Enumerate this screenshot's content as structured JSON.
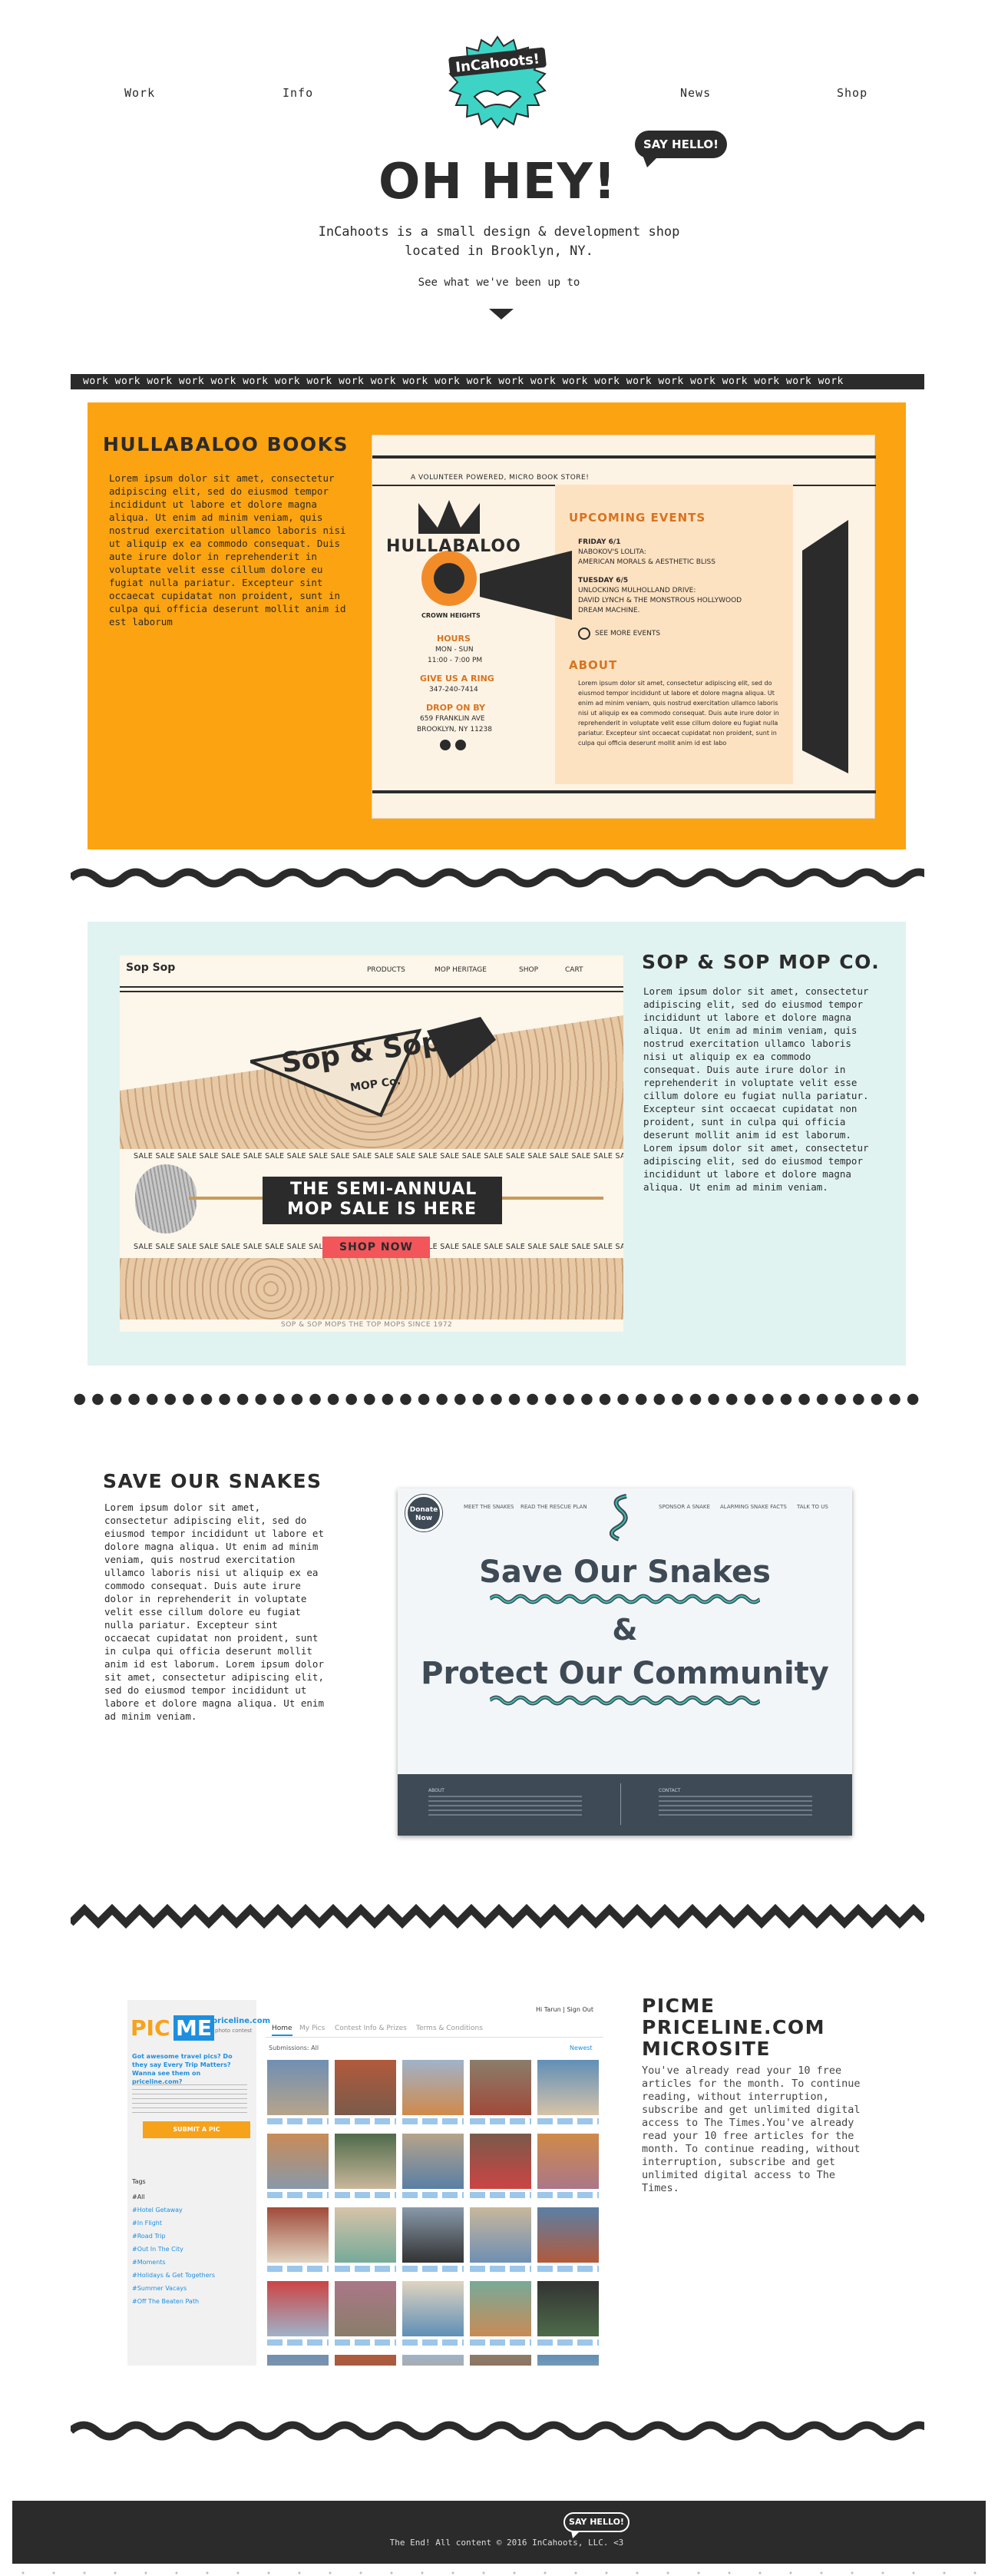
{
  "nav": {
    "work": "Work",
    "info": "Info",
    "logo_text": "InCahoots!",
    "news": "News",
    "shop": "Shop"
  },
  "hero": {
    "title": "OH HEY!",
    "say_hello": "SAY HELLO!",
    "subtitle_line1": "InCahoots is a small design & development shop",
    "subtitle_line2": "located in Brooklyn, NY.",
    "see_link": "See what we've been up to"
  },
  "work_bar": "work work work work work work work work work work work work work work work work work work work work work work work work",
  "projects": {
    "hullabaloo": {
      "title": "HULLABALOO BOOKS",
      "body": "Lorem ipsum dolor sit amet, consectetur adipiscing elit, sed do eiusmod tempor incididunt ut labore et dolore magna aliqua. Ut enim ad minim veniam, quis nostrud exercitation ullamco laboris nisi ut aliquip ex ea commodo consequat. Duis aute irure dolor in reprehenderit in voluptate velit esse cillum dolore eu fugiat nulla pariatur. Excepteur sint occaecat cupidatat non proident, sunt in culpa qui officia deserunt mollit anim id est laborum",
      "bg_color": "#fca311",
      "mock": {
        "tagline": "A VOLUNTEER POWERED, MICRO BOOK STORE!",
        "brand": "HULLABALOO",
        "location": "CROWN HEIGHTS",
        "hours_title": "HOURS",
        "hours_days": "MON - SUN",
        "hours_time": "11:00 - 7:00 PM",
        "ring_title": "GIVE US A RING",
        "phone": "347-240-7414",
        "drop_title": "DROP ON BY",
        "address1": "659 FRANKLIN AVE",
        "address2": "BROOKLYN, NY 11238",
        "events_title": "UPCOMING EVENTS",
        "event1_date": "FRIDAY 6/1",
        "event1_l1": "NABOKOV'S LOLITA:",
        "event1_l2": "AMERICAN MORALS & AESTHETIC BLISS",
        "event2_date": "TUESDAY 6/5",
        "event2_l1": "UNLOCKING MULHOLLAND DRIVE:",
        "event2_l2": "DAVID LYNCH & THE MONSTROUS HOLLYWOOD",
        "event2_l3": "DREAM MACHINE.",
        "see_more": "SEE MORE EVENTS",
        "about_title": "ABOUT",
        "about_body": "Lorem ipsum dolor sit amet, consectetur adipiscing elit, sed do eiusmod tempor incididunt ut labore et dolore magna aliqua. Ut enim ad minim veniam, quis nostrud exercitation ullamco laboris nisi ut aliquip ex ea commodo consequat. Duis aute irure dolor in reprehenderit in voluptate velit esse cillum dolore eu fugiat nulla pariatur. Excepteur sint occaecat cupidatat non proident, sunt in culpa qui officia deserunt mollit anim id est labo"
      }
    },
    "sopsop": {
      "title": "SOP & SOP MOP CO.",
      "body": "Lorem ipsum dolor sit amet, consectetur adipiscing elit, sed do eiusmod tempor incididunt ut labore et dolore magna aliqua. Ut enim ad minim veniam, quis nostrud exercitation ullamco laboris nisi ut aliquip ex ea commodo consequat. Duis aute irure dolor in reprehenderit in voluptate velit esse cillum dolore eu fugiat nulla pariatur. Excepteur sint occaecat cupidatat non proident, sunt in culpa qui officia deserunt mollit anim id est laborum. Lorem ipsum dolor sit amet, consectetur adipiscing elit, sed do eiusmod tempor incididunt ut labore et dolore magna aliqua. Ut enim ad minim veniam.",
      "bg_color": "#e0f3f1",
      "mock": {
        "logo": "Sop Sop",
        "nav_products": "PRODUCTS",
        "nav_heritage": "MOP HERITAGE",
        "nav_shop": "SHOP",
        "nav_cart": "CART",
        "sign_brand": "Sop & Sop",
        "sign_sub": "MOP Co.",
        "sale_strip": "SALE SALE SALE SALE SALE SALE SALE SALE SALE SALE SALE SALE SALE SALE SALE SALE SALE SALE SALE SALE SALE SALE SALE SALE",
        "banner_l1": "THE SEMI-ANNUAL",
        "banner_l2": "MOP SALE IS HERE",
        "shop_now": "SHOP NOW",
        "footer": "SOP & SOP MOPS THE TOP MOPS SINCE 1972"
      }
    },
    "snakes": {
      "title": "SAVE OUR SNAKES",
      "body": "Lorem ipsum dolor sit amet, consectetur adipiscing elit, sed do eiusmod tempor incididunt ut labore et dolore magna aliqua. Ut enim ad minim veniam, quis nostrud exercitation ullamco laboris nisi ut aliquip ex ea commodo consequat. Duis aute irure dolor in reprehenderit in voluptate velit esse cillum dolore eu fugiat nulla pariatur. Excepteur sint occaecat cupidatat non proident, sunt in culpa qui officia deserunt mollit anim id est laborum. Lorem ipsum dolor sit amet, consectetur adipiscing elit, sed do eiusmod tempor incididunt ut labore et dolore magna aliqua. Ut enim ad minim veniam.",
      "mock": {
        "donate": "Donate Now",
        "nav1": "MEET THE SNAKES",
        "nav2": "READ THE RESCUE PLAN",
        "nav3": "SPONSOR A SNAKE",
        "nav4": "ALARMING SNAKE FACTS",
        "nav5": "TALK TO US",
        "headline1": "Save Our Snakes",
        "amp": "&",
        "headline2": "Protect Our Community",
        "footer_left_title": "ABOUT",
        "footer_right_title": "CONTACT"
      }
    },
    "picme": {
      "title_l1": "PICME",
      "title_l2": "PRICELINE.COM",
      "title_l3": "MICROSITE",
      "body": "You've already read your 10 free articles for the month. To continue reading, without interruption, subscribe and get unlimited digital access to The Times.You've already read your 10 free articles for the month. To continue reading, without interruption, subscribe and get unlimited digital access to The Times.",
      "mock": {
        "logo_pic": "PIC",
        "logo_me": "ME",
        "logo_priceline": "priceline.com",
        "logo_sub": "photo contest",
        "greeting": "Hi Tarun | Sign Out",
        "tab_home": "Home",
        "tab_my_pics": "My Pics",
        "tab_contest": "Contest Info & Prizes",
        "tab_terms": "Terms & Conditions",
        "promo_title": "Got awesome travel pics? Do they say Every Trip Matters? Wanna see them on priceline.com?",
        "submit": "SUBMIT A PIC",
        "submissions": "Submissions: All",
        "newest": "Newest",
        "tags_title": "Tags",
        "tags": [
          "#All",
          "#Hotel Getaway",
          "#In Flight",
          "#Road Trip",
          "#Out In The City",
          "#Moments",
          "#Holidays & Get Togethers",
          "#Summer Vacays",
          "#Off The Beaten Path"
        ]
      }
    }
  },
  "footer": {
    "text": "The End! All content © 2016 InCahoots, LLC. <3",
    "say_hello": "SAY HELLO!"
  },
  "colors": {
    "ink": "#2b2b2b",
    "orange": "#fca311",
    "mint": "#e0f3f1",
    "teal": "#3dd4c6",
    "coral": "#f2555a",
    "picme_blue": "#1d8fe0",
    "slate": "#3e4a55"
  }
}
